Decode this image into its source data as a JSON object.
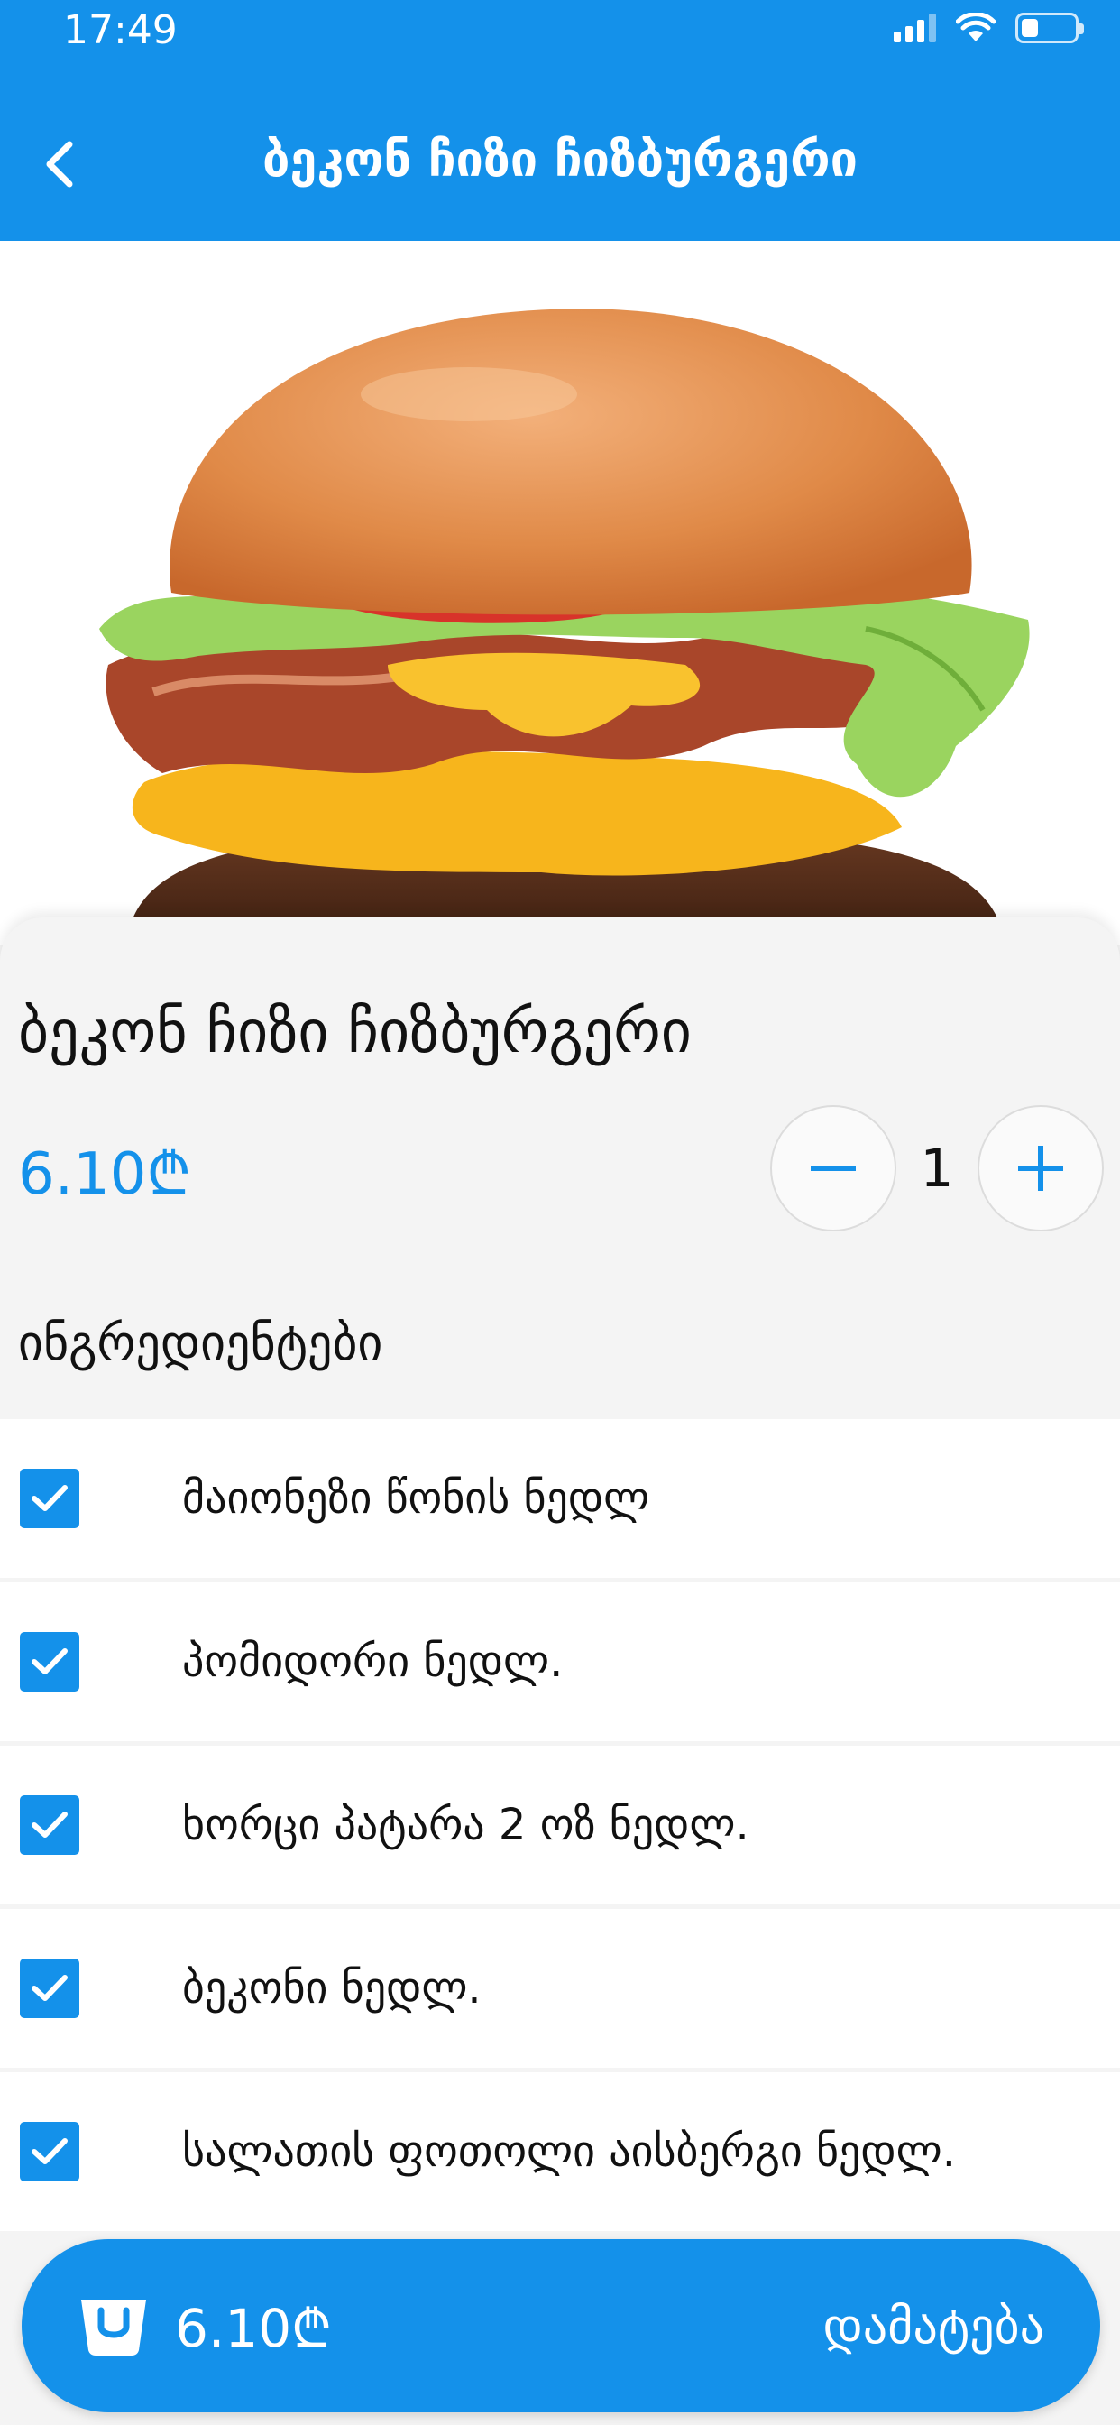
{
  "status_bar": {
    "time": "17:49"
  },
  "header": {
    "title": "ბეკონ ჩიზი ჩიზბურგერი"
  },
  "product": {
    "name": "ბეკონ ჩიზი ჩიზბურგერი",
    "price": "6.10₾",
    "quantity": "1"
  },
  "ingredients": {
    "title": "ინგრედიენტები",
    "items": [
      {
        "label": "მაიონეზი წონის ნედლ",
        "checked": true
      },
      {
        "label": "პომიდორი ნედლ.",
        "checked": true
      },
      {
        "label": "ხორცი პატარა 2 ოზ ნედლ.",
        "checked": true
      },
      {
        "label": "ბეკონი ნედლ.",
        "checked": true
      },
      {
        "label": "სალათის ფოთოლი აისბერგი ნედლ.",
        "checked": true
      }
    ]
  },
  "add_bar": {
    "price": "6.10₾",
    "label": "დამატება"
  },
  "colors": {
    "accent": "#1491ea",
    "background": "#f4f4f4"
  },
  "icons": [
    "back-chevron-icon",
    "signal-icon",
    "wifi-icon",
    "battery-icon",
    "minus-icon",
    "plus-icon",
    "checkbox-checked-icon",
    "basket-icon"
  ]
}
